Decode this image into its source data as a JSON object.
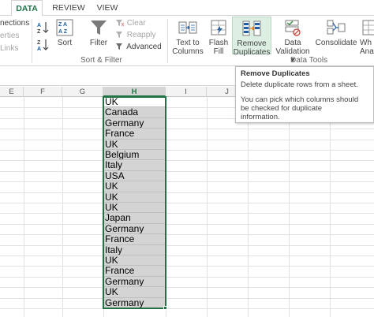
{
  "tabs": [
    {
      "label": "DATA",
      "active": true
    },
    {
      "label": "REVIEW",
      "active": false
    },
    {
      "label": "VIEW",
      "active": false
    }
  ],
  "connections": {
    "items": [
      "nections",
      "erties",
      "Links"
    ]
  },
  "sort_filter": {
    "sort_label": "Sort",
    "filter_label": "Filter",
    "clear_label": "Clear",
    "reapply_label": "Reapply",
    "advanced_label": "Advanced",
    "group_label": "Sort & Filter"
  },
  "data_tools": {
    "text_to_columns": [
      "Text to",
      "Columns"
    ],
    "flash_fill": [
      "Flash",
      "Fill"
    ],
    "remove_duplicates": [
      "Remove",
      "Duplicates"
    ],
    "data_validation": [
      "Data",
      "Validation ▾"
    ],
    "consolidate_label": "Consolidate",
    "what_if": [
      "Wh",
      "Ana"
    ],
    "group_label": "Data Tools"
  },
  "columns": [
    "E",
    "F",
    "G",
    "H",
    "I",
    "J"
  ],
  "selected_column": "H",
  "cells": [
    "UK",
    "Canada",
    "Germany",
    "France",
    "UK",
    "Belgium",
    "Italy",
    "USA",
    "UK",
    "UK",
    "UK",
    "Japan",
    "Germany",
    "France",
    "Italy",
    "UK",
    "France",
    "Germany",
    "UK",
    "Germany"
  ],
  "tooltip": {
    "title": "Remove Duplicates",
    "description": "Delete duplicate rows from a sheet.",
    "detail_lines": [
      "You can pick which columns should",
      "be checked for duplicate",
      "information."
    ]
  },
  "colors": {
    "accent": "#217346",
    "selection_fill": "#d4d4d4",
    "hover_fill": "#dcefe2"
  }
}
